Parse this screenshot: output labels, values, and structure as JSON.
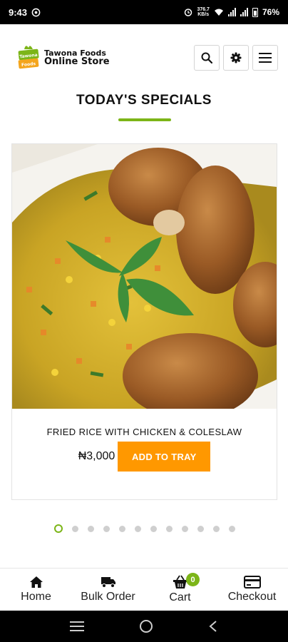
{
  "status_bar": {
    "time": "9:43",
    "net_speed_top": "376.7",
    "net_speed_bottom": "KB/s",
    "battery": "76%"
  },
  "header": {
    "logo_title_line1": "Tawona Foods",
    "logo_title_line2": "Online Store",
    "logo_badge_line1": "Tawona",
    "logo_badge_line2": "Foods",
    "icons": [
      "search-icon",
      "gear-icon",
      "menu-icon"
    ]
  },
  "section": {
    "title": "TODAY'S SPECIALS"
  },
  "product": {
    "name": "FRIED RICE WITH CHICKEN & COLESLAW",
    "price": "₦3,000",
    "button_label": "ADD TO TRAY"
  },
  "carousel": {
    "dot_count": 12,
    "active_index": 0
  },
  "bottom_nav": {
    "items": [
      {
        "label": "Home",
        "icon": "home-icon"
      },
      {
        "label": "Bulk Order",
        "icon": "truck-icon"
      },
      {
        "label": "Cart",
        "icon": "basket-icon",
        "badge": "0"
      },
      {
        "label": "Checkout",
        "icon": "credit-card-icon"
      }
    ]
  },
  "colors": {
    "accent_green": "#7cb518",
    "button_orange": "#ff9800"
  }
}
